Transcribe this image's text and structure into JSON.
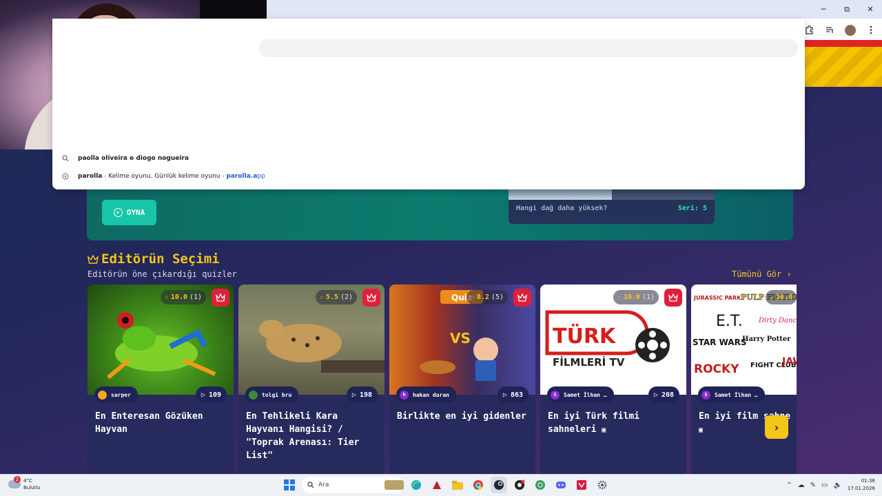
{
  "window": {
    "minimize_icon": "─",
    "restore_icon": "⧉",
    "close_icon": "✕"
  },
  "omnibox": {
    "suggestions": [
      {
        "icon": "search-icon",
        "text": "paolla oliveira e diogo nogueira"
      },
      {
        "icon": "history-icon",
        "title": "parolla",
        "separator1": " - ",
        "description": "Kelime oyunu. Günlük kelime oyunu",
        "separator2": " - ",
        "url_bold": "parolla.a",
        "url_rest": "pp"
      }
    ]
  },
  "hero": {
    "play_label": "OYNA",
    "question": "Hangi dağ daha yüksek?",
    "streak": "Seri: 5"
  },
  "section": {
    "title": "Editörün Seçimi",
    "subtitle": "Editörün öne çıkardığı quizler",
    "see_all": "Tümünü Gör ›"
  },
  "cards": [
    {
      "rating": "10.0",
      "rating_count": "(1)",
      "author": "sarper",
      "author_initial": "",
      "plays": "109",
      "title": "En Enteresan Gözüken Hayvan"
    },
    {
      "rating": "5.5",
      "rating_count": "(2)",
      "author": "tolgi bru",
      "author_initial": "",
      "plays": "198",
      "title": "En Tehlikeli Kara Hayvanı Hangisi? / \"Toprak Arenası: Tier List\""
    },
    {
      "rating": "8.2",
      "rating_count": "(5)",
      "author": "hakan duran",
      "author_initial": "h",
      "plays": "863",
      "title": "Birlikte en iyi gidenler"
    },
    {
      "rating": "10.0",
      "rating_count": "(1)",
      "author": "Samet İlhan …",
      "author_initial": "S",
      "plays": "208",
      "title": "En iyi Türk filmi sahneleri"
    },
    {
      "rating": "10.0",
      "rating_count": "",
      "author": "Samet İlhan …",
      "author_initial": "S",
      "plays": "",
      "title": "En iyi film sahne"
    }
  ],
  "card_image_text": {
    "quiz_badge": "Quiz",
    "vs": "VS",
    "turk_1": "TÜRK",
    "turk_2": "FİLMLERİ TV",
    "films": [
      "JURASSIC PARK",
      "PULP FICTION",
      "E.T.",
      "Dirty Dancing",
      "Harry Potter",
      "STAR WARS",
      "ROCKY",
      "FIGHT CLUB",
      "JAWS"
    ]
  },
  "next_arrow": "›",
  "taskbar": {
    "weather_temp": "4°C",
    "weather_desc": "Bulutlu",
    "weather_badge": "2",
    "search_placeholder": "Ara",
    "time": "01:36",
    "date": "17.01.2026"
  },
  "colors": {
    "accent_yellow": "#f5c518",
    "crown_red": "#e0203a",
    "teal": "#19c5a8",
    "streak_green": "#2ee6a8"
  }
}
